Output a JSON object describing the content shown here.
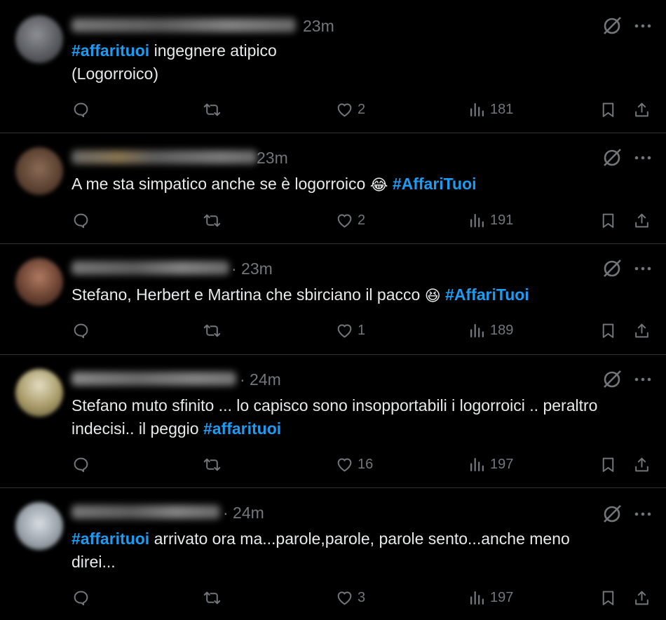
{
  "colors": {
    "background": "#000000",
    "text": "#e7e9ea",
    "muted": "#71767b",
    "hashtag": "#1d9bf0",
    "divider": "#2f3336"
  },
  "icons": [
    "grok-icon",
    "more-icon",
    "reply-icon",
    "retweet-icon",
    "like-icon",
    "views-icon",
    "bookmark-icon",
    "share-icon"
  ],
  "tweets": [
    {
      "time": "23m",
      "text_parts": [
        {
          "text": "#affarituoi",
          "hashtag": true
        },
        {
          "text": " ingegnere atipico",
          "hashtag": false
        },
        {
          "text": "(Logorroico)",
          "hashtag": false,
          "newline": true
        }
      ],
      "likes": "2",
      "views": "181"
    },
    {
      "time": "23m",
      "text_parts": [
        {
          "text": "A me sta simpatico anche se è logorroico ",
          "hashtag": false
        },
        {
          "text": "😂",
          "emoji": true
        },
        {
          "text": " ",
          "hashtag": false
        },
        {
          "text": "#AffariTuoi",
          "hashtag": true
        }
      ],
      "likes": "2",
      "views": "191"
    },
    {
      "time": "· 23m",
      "text_parts": [
        {
          "text": "Stefano, Herbert e Martina che sbirciano il pacco ",
          "hashtag": false
        },
        {
          "text": "😆",
          "emoji": true
        },
        {
          "text": " ",
          "hashtag": false
        },
        {
          "text": "#AffariTuoi",
          "hashtag": true
        }
      ],
      "likes": "1",
      "views": "189"
    },
    {
      "time": "· 24m",
      "text_parts": [
        {
          "text": "Stefano muto sfinito ... lo capisco sono insopportabili  i logorroici .. peraltro indecisi.. il peggio  ",
          "hashtag": false
        },
        {
          "text": "#affarituoi",
          "hashtag": true
        }
      ],
      "likes": "16",
      "views": "197"
    },
    {
      "time": "· 24m",
      "text_parts": [
        {
          "text": "#affarituoi",
          "hashtag": true
        },
        {
          "text": " arrivato ora ma...parole,parole, parole sento...anche meno direi...",
          "hashtag": false
        }
      ],
      "likes": "3",
      "views": "197"
    }
  ]
}
